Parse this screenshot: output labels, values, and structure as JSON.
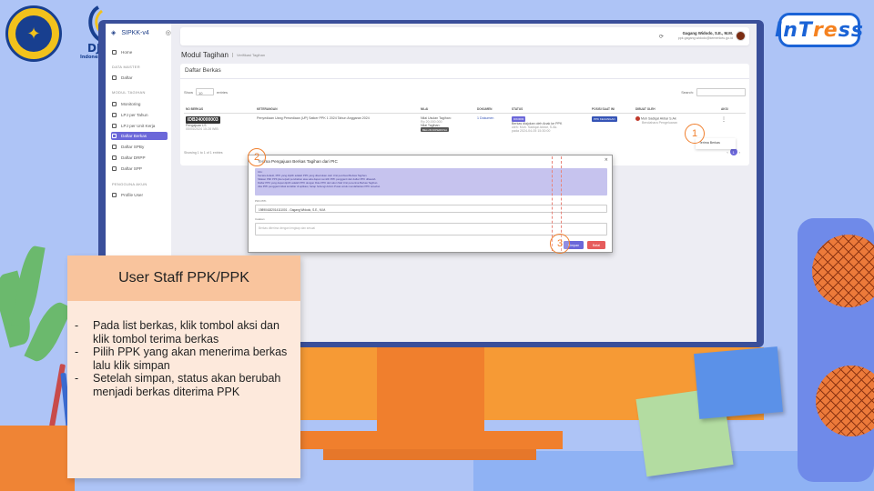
{
  "logos": {
    "kemenkeu_icon": "emblem-icon",
    "djpb_text": "DJ",
    "djpb_sub": "Indonesia",
    "intress_a": "InT",
    "intress_b": "re",
    "intress_c": "ss"
  },
  "app": {
    "brand": "SIPKK-v4",
    "sidebar": {
      "items": [
        {
          "label": "Home"
        },
        {
          "label": "Daftar"
        },
        {
          "label": "Monitoring"
        },
        {
          "label": "LPJ per Tahun"
        },
        {
          "label": "LPJ per Unit Kerja"
        },
        {
          "label": "Daftar Berkas"
        },
        {
          "label": "Daftar SPBy"
        },
        {
          "label": "Daftar DRPP"
        },
        {
          "label": "Daftar SPP"
        },
        {
          "label": "Profile User"
        }
      ],
      "heads": [
        "DATA MASTER",
        "MODUL TAGIHAN",
        "PENGGUNA AKUN"
      ]
    },
    "user": {
      "name": "Gagang Widodo, S.E., M.M.",
      "email": "ppk.gagang.widodo@kemenkeu.go.id"
    },
    "page_title": "Modul Tagihan",
    "breadcrumb": "Verifikasi Tagihan",
    "panel_title": "Daftar Berkas",
    "show_label": "Show",
    "show_value": "10",
    "entries_label": "entries",
    "search_label": "Search:",
    "table": {
      "headers": [
        "No Berkas",
        "Keterangan",
        "Nilai",
        "Dokumen",
        "Status",
        "Posisi Saat Ini",
        "Dibuat Oleh",
        "Aksi"
      ],
      "row": {
        "no_berkas": "IDB240000003",
        "jenis": "Pengajuan LS",
        "tgl": "05/04/2024 15:28 WIB",
        "keterangan": "Penyediaan Uang Persediaan (UP) Satker PPK 1 2024 Tahun Anggaran 2024",
        "nilai_1": "Nilai Usulan Tagihan:",
        "nilai_2": "Rp 20.000.000",
        "nilai_3": "Nilai Tagihan:",
        "nilai_badge": "BELUM DIPERIKSA",
        "dokumen": "1 Dokumen",
        "status_badge": "DIKIRIM",
        "status_text": "Berkas diajukan oleh Anak ke PPK",
        "status_sub": "oleh: Muh. Sadiqal Akbar, S.Ak.",
        "status_date": "pada 2024-04-05 15:30:00",
        "posisi": "PPK KEUANGAN",
        "dibuat": "Muh Sadiqal Akbar S.Ak",
        "dibuat_sub": "Bendahara Pengeluaran",
        "aksi": "⋮"
      }
    },
    "showing": "Showing 1 to 1 of 1 entries",
    "pager": {
      "prev": "‹",
      "page": "1",
      "next": "›"
    },
    "dropdown_item": "Terima Berkas",
    "modal": {
      "title": "Terima Pengajuan Berkas Tagihan dari PIC",
      "info": [
        "Info:",
        "Secara default, PPK yang dipilih adalah PPK yang ditentukan oleh Unit pembuat Berkas Tagihan.",
        "Silakan Pilih PPK jika terjadi perubahan atau ada dapat memilih PPK pengganti dari daftar PPK dibawah.",
        "Daftar PPK yang dapat dipilih adalah PPK dengan Role PPK dari akun Staf Unit penerima Berkas Tagihan.",
        "Jika PPK pengganti tidak terdaftar di aplikasi, harap hubungi Admin Pusat untuk mendaftarkan PPK tersebut."
      ],
      "ppk_label": "Pilih PPK",
      "ppk_value": "198904182014111001 - Gagang Widodo, S.E., M.M.",
      "catatan_label": "Catatan",
      "catatan_placeholder": "Berkas diterima dengan lengkap dan sesuai",
      "save": "Simpan",
      "cancel": "Batal"
    },
    "annotations": [
      "1",
      "2",
      "3"
    ]
  },
  "card": {
    "title": "User Staff PPK/PPK",
    "points": [
      "Pada list berkas, klik tombol aksi dan klik tombol terima berkas",
      "Pilih PPK yang akan menerima berkas lalu klik simpan",
      "Setelah simpan, status akan berubah menjadi berkas diterima PPK"
    ]
  },
  "colors": {
    "background": "#aec4f6",
    "accent": "#6b67d9",
    "danger": "#e65c5c",
    "orange": "#f07f2d"
  }
}
